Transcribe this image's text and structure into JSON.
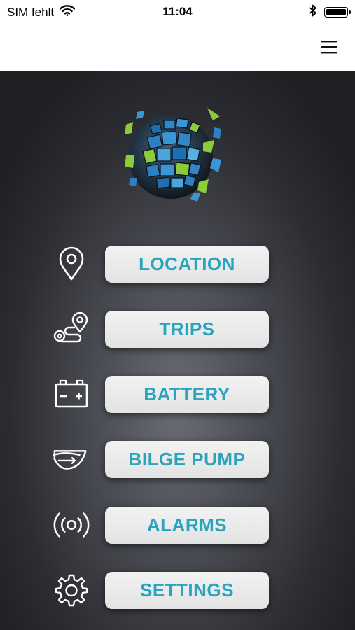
{
  "status_bar": {
    "carrier": "SIM fehlt",
    "time": "11:04",
    "icons": [
      "wifi-icon",
      "bluetooth-icon",
      "battery-icon"
    ]
  },
  "nav_bar": {
    "menu_icon": "hamburger-menu-icon"
  },
  "logo": {
    "icon": "globe-mosaic-logo"
  },
  "menu": {
    "items": [
      {
        "label": "LOCATION",
        "icon": "map-pin-icon"
      },
      {
        "label": "TRIPS",
        "icon": "route-icon"
      },
      {
        "label": "BATTERY",
        "icon": "battery-icon"
      },
      {
        "label": "BILGE PUMP",
        "icon": "bilge-pump-icon"
      },
      {
        "label": "ALARMS",
        "icon": "alarm-broadcast-icon"
      },
      {
        "label": "SETTINGS",
        "icon": "gear-icon"
      }
    ]
  },
  "colors": {
    "accent_text": "#2aa3bd",
    "button_bg": "#ececec",
    "background_dark": "#2c2d32",
    "logo_green": "#8ccc3a",
    "logo_blue": "#2b7fc4"
  }
}
